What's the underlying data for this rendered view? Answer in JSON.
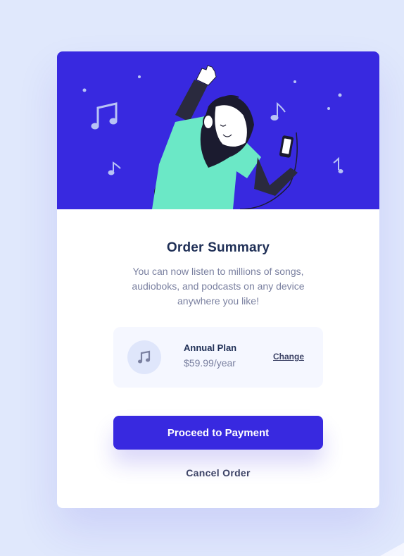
{
  "card": {
    "title": "Order Summary",
    "description": "You can now listen to millions of songs, audioboks, and podcasts on any device anywhere you like!"
  },
  "plan": {
    "icon": "music-note-icon",
    "name": "Annual Plan",
    "price": "$59.99/year",
    "change_label": "Change"
  },
  "actions": {
    "pay_label": "Proceed to Payment",
    "cancel_label": "Cancel Order"
  },
  "colors": {
    "background": "#e0e8fc",
    "hero": "#3829e0",
    "accent": "#3829e0",
    "title": "#1f2f56",
    "body_text": "#7a80a0",
    "plan_bg": "#f5f7ff",
    "figure_shirt": "#6be8c6"
  }
}
